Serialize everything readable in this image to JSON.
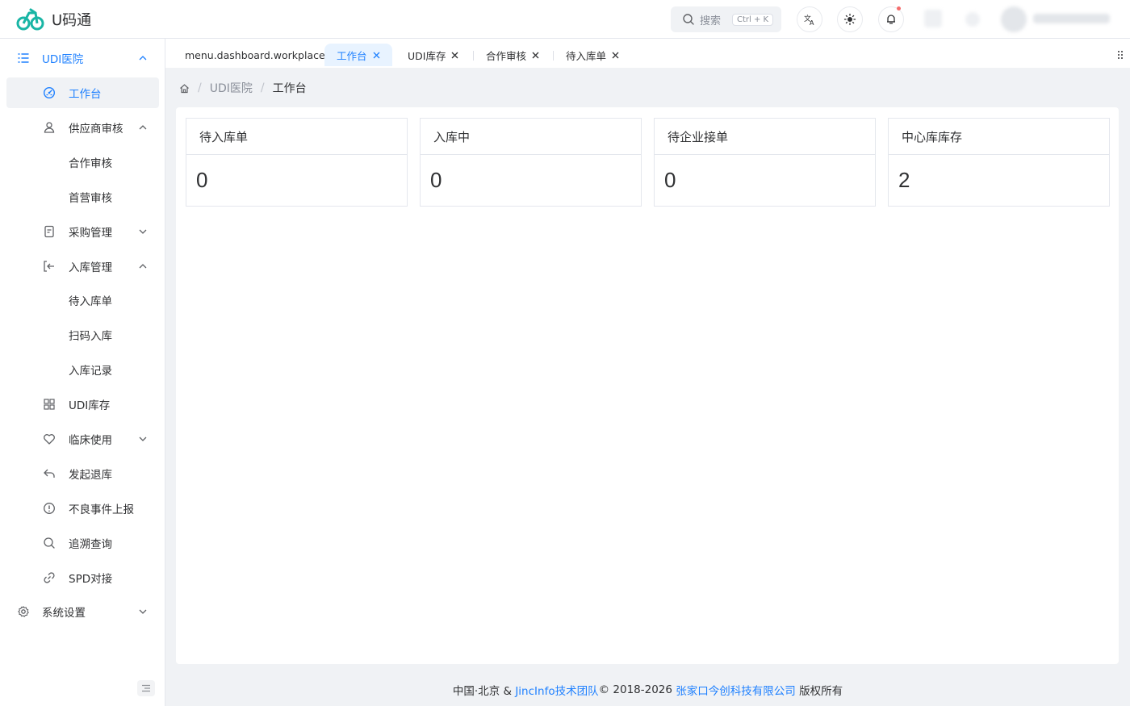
{
  "app": {
    "name": "U码通"
  },
  "header": {
    "search_placeholder": "搜索",
    "search_shortcut": "Ctrl + K",
    "icons": [
      "translate-icon",
      "theme-icon",
      "bell-icon"
    ]
  },
  "sidebar": {
    "root": "UDI医院",
    "items": [
      {
        "label": "工作台",
        "icon": "dashboard-icon"
      },
      {
        "label": "供应商审核",
        "icon": "user-icon"
      },
      {
        "label": "合作审核"
      },
      {
        "label": "首营审核"
      },
      {
        "label": "采购管理",
        "icon": "document-icon"
      },
      {
        "label": "入库管理",
        "icon": "login-icon"
      },
      {
        "label": "待入库单"
      },
      {
        "label": "扫码入库"
      },
      {
        "label": "入库记录"
      },
      {
        "label": "UDI库存",
        "icon": "grid-icon"
      },
      {
        "label": "临床使用",
        "icon": "heart-icon"
      },
      {
        "label": "发起退库",
        "icon": "back-icon"
      },
      {
        "label": "不良事件上报",
        "icon": "info-icon"
      },
      {
        "label": "追溯查询",
        "icon": "search-icon"
      },
      {
        "label": "SPD对接",
        "icon": "link-icon"
      }
    ],
    "settings": "系统设置"
  },
  "tabs": [
    "menu.dashboard.workplace",
    "工作台",
    "UDI库存",
    "合作审核",
    "待入库单"
  ],
  "breadcrumb": [
    "UDI医院",
    "工作台"
  ],
  "stats": [
    {
      "title": "待入库单",
      "value": "0"
    },
    {
      "title": "入库中",
      "value": "0"
    },
    {
      "title": "待企业接单",
      "value": "0"
    },
    {
      "title": "中心库库存",
      "value": "2"
    }
  ],
  "footer": {
    "prefix": "中国·北京 &",
    "team": "JincInfo技术团队",
    "copyright": "© 2018-2026",
    "company": "张家口今创科技有限公司",
    "suffix": "版权所有"
  },
  "colors": {
    "accent": "#1e80ff",
    "notification_dot": "#f56c6c"
  }
}
